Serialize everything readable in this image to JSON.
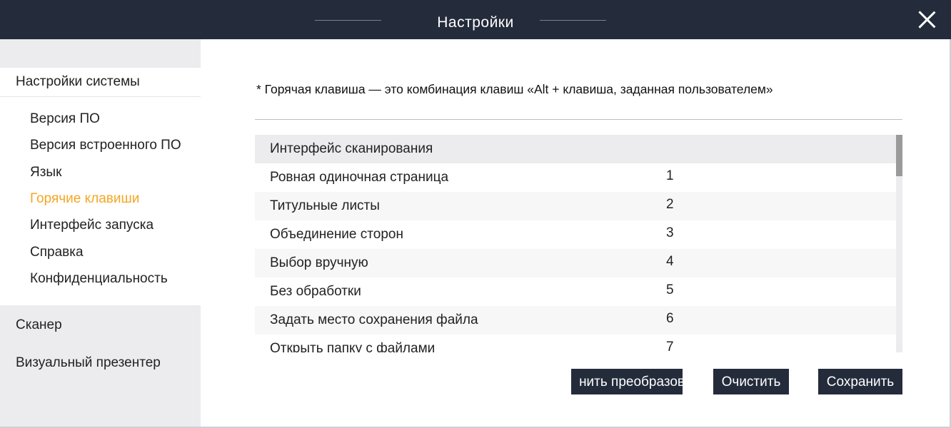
{
  "window": {
    "title": "Настройки"
  },
  "sidebar": {
    "system_section": "Настройки системы",
    "items": [
      {
        "label": "Версия ПО"
      },
      {
        "label": "Версия встроенного ПО"
      },
      {
        "label": "Язык"
      },
      {
        "label": "Горячие клавиши",
        "active": true
      },
      {
        "label": "Интерфейс запуска"
      },
      {
        "label": "Справка"
      },
      {
        "label": "Конфиденциальность"
      }
    ],
    "scanner_section": "Сканер",
    "presenter_section": "Визуальный презентер"
  },
  "main": {
    "note": "* Горячая клавиша — это комбинация клавиш «Alt + клавиша, заданная пользователем»",
    "table": {
      "header": "Интерфейс сканирования",
      "rows": [
        {
          "name": "Ровная одиночная страница",
          "key": "1"
        },
        {
          "name": "Титульные листы",
          "key": "2"
        },
        {
          "name": "Объединение сторон",
          "key": "3"
        },
        {
          "name": "Выбор вручную",
          "key": "4"
        },
        {
          "name": "Без обработки",
          "key": "5"
        },
        {
          "name": "Задать место сохранения файла",
          "key": "6"
        },
        {
          "name": "Открыть папку с файлами",
          "key": "7"
        }
      ]
    },
    "buttons": {
      "restore": "нить преобразов",
      "clear": "Очистить",
      "save": "Сохранить"
    }
  },
  "colors": {
    "titlebar": "#242b3b",
    "accent_active": "#f5a623",
    "sidebar_bg": "#ececee"
  }
}
